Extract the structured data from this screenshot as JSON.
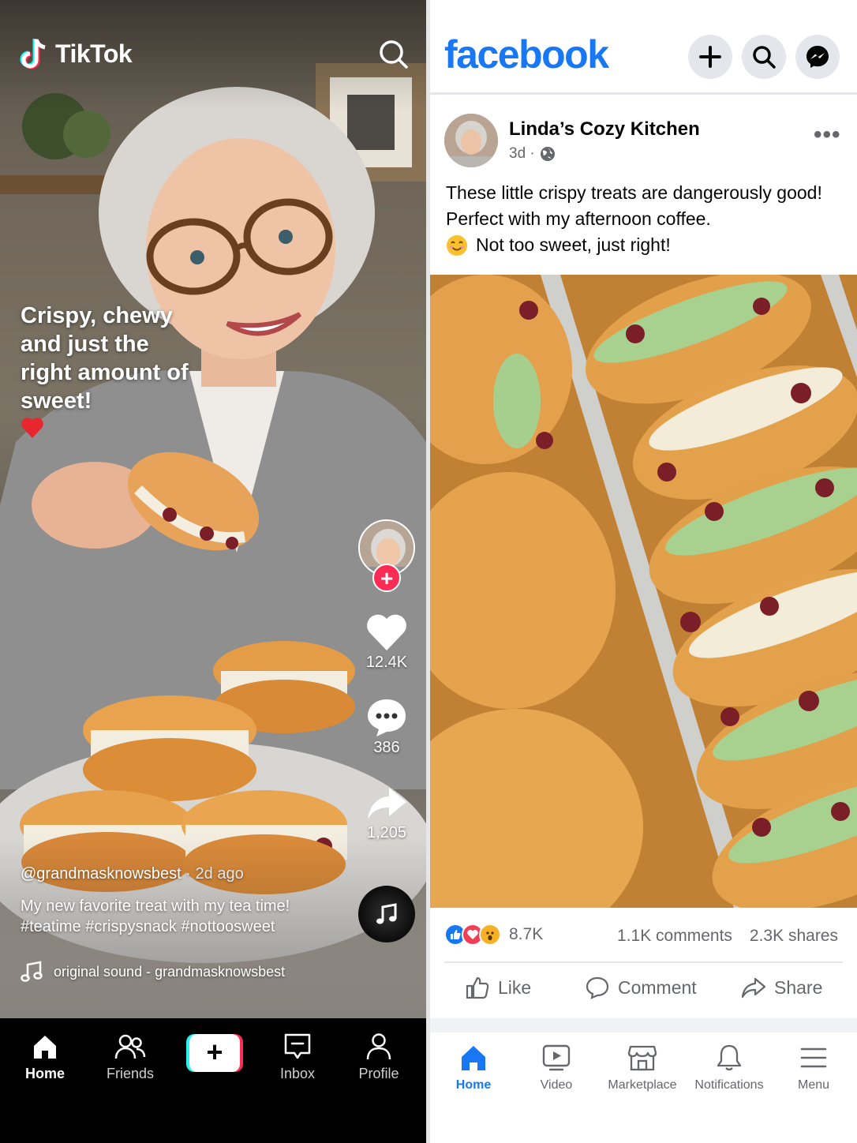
{
  "tiktok": {
    "logo_text": "TikTok",
    "caption": "Crispy, chewy and just the right amount of sweet!",
    "likes": "12.4K",
    "comments": "386",
    "shares": "1,205",
    "username": "@grandmasknowsbest",
    "posted": "· 2d ago",
    "description": "My new favorite treat with my tea time! #teatime #crispysnack #nottoosweet",
    "sound": "original sound - grandmasknowsbest",
    "follow_symbol": "+",
    "nav": {
      "home": "Home",
      "friends": "Friends",
      "create": "+",
      "inbox": "Inbox",
      "profile": "Profile"
    },
    "colors": {
      "accent_red": "#fe2c55",
      "accent_cyan": "#25f4ee"
    }
  },
  "facebook": {
    "logo_text": "facebook",
    "page_name": "Linda’s Cozy Kitchen",
    "time": "3d ·",
    "more": "•••",
    "post_text": "These little crispy treats are dangerously good! Perfect with my afternoon coffee.",
    "post_text_2": "Not too sweet, just right!",
    "reactions_count": "8.7K",
    "comments_count": "1.1K comments",
    "shares_count": "2.3K shares",
    "actions": {
      "like": "Like",
      "comment": "Comment",
      "share": "Share"
    },
    "nav": {
      "home": "Home",
      "video": "Video",
      "marketplace": "Marketplace",
      "notifications": "Notifications",
      "menu": "Menu"
    },
    "colors": {
      "brand_blue": "#1877f2",
      "secondary_text": "#65676b"
    }
  }
}
